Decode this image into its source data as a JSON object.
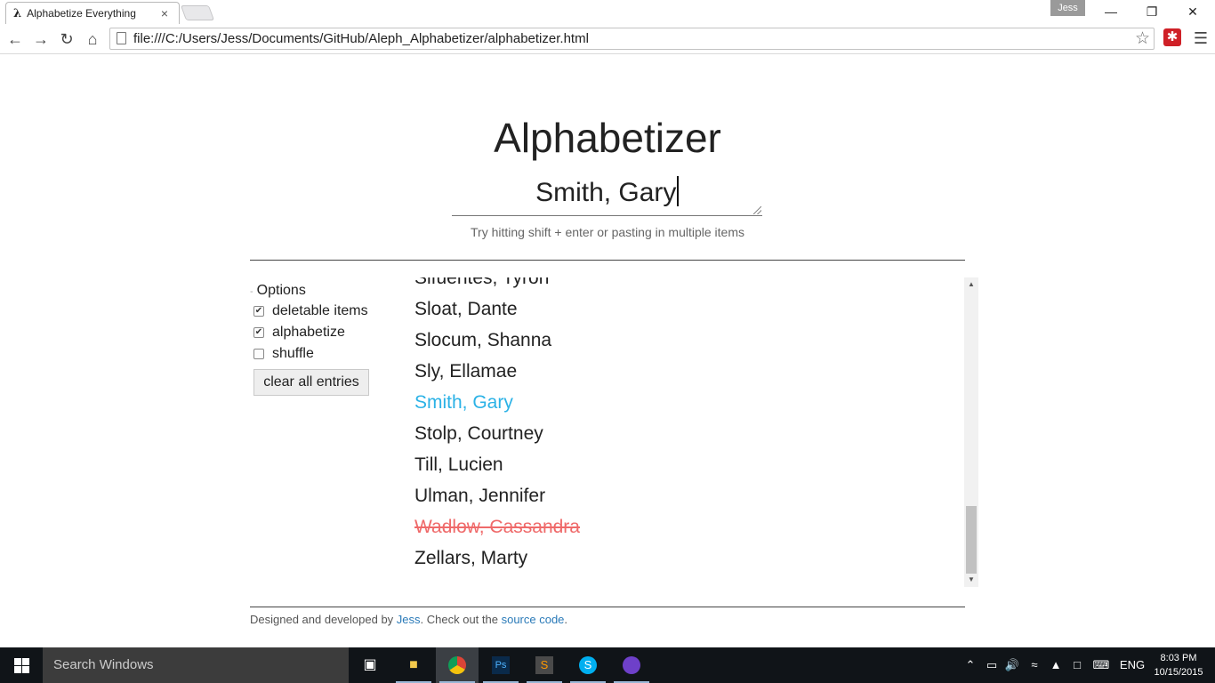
{
  "browser": {
    "tab_title": "Alphabetize Everything",
    "tab_favicon": "λ",
    "profile_name": "Jess",
    "url": "file:///C:/Users/Jess/Documents/GitHub/Aleph_Alphabetizer/alphabetizer.html"
  },
  "page": {
    "title": "Alphabetizer",
    "entry_value": "Smith, Gary",
    "hint": "Try hitting shift + enter or pasting in multiple items"
  },
  "options": {
    "heading": "Options",
    "deletable_label": "deletable items",
    "deletable_checked": true,
    "alphabetize_label": "alphabetize",
    "alphabetize_checked": true,
    "shuffle_label": "shuffle",
    "shuffle_checked": false,
    "clear_button": "clear all entries"
  },
  "list": {
    "items": [
      {
        "text": "Sifuentes, Tyron",
        "state": "normal"
      },
      {
        "text": "Sloat, Dante",
        "state": "normal"
      },
      {
        "text": "Slocum, Shanna",
        "state": "normal"
      },
      {
        "text": "Sly, Ellamae",
        "state": "normal"
      },
      {
        "text": "Smith, Gary",
        "state": "highlight"
      },
      {
        "text": "Stolp, Courtney",
        "state": "normal"
      },
      {
        "text": "Till, Lucien",
        "state": "normal"
      },
      {
        "text": "Ulman, Jennifer",
        "state": "normal"
      },
      {
        "text": "Wadlow, Cassandra",
        "state": "deleted"
      },
      {
        "text": "Zellars, Marty",
        "state": "normal"
      }
    ],
    "colors": {
      "highlight": "#2bb2e6",
      "deleted": "#ef6a6a"
    }
  },
  "footer": {
    "prefix": "Designed and developed by ",
    "author_link": "Jess",
    "middle": ". Check out the ",
    "source_link": "source code",
    "suffix": "."
  },
  "taskbar": {
    "search_placeholder": "Search Windows",
    "language": "ENG",
    "time": "8:03 PM",
    "date": "10/15/2015"
  }
}
